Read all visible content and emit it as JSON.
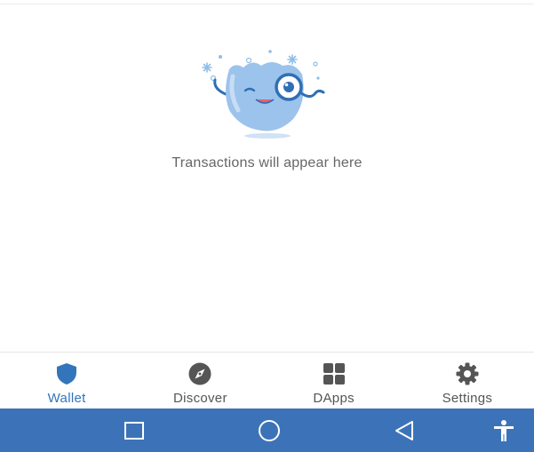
{
  "empty_state": {
    "message": "Transactions will appear here",
    "illustration_icon": "mascot-magnifier-illustration"
  },
  "bottom_nav": {
    "items": [
      {
        "label": "Wallet",
        "icon": "shield-icon",
        "active": true
      },
      {
        "label": "Discover",
        "icon": "compass-icon",
        "active": false
      },
      {
        "label": "DApps",
        "icon": "grid-icon",
        "active": false
      },
      {
        "label": "Settings",
        "icon": "gear-icon",
        "active": false
      }
    ]
  },
  "system_nav": {
    "buttons": [
      "recents-square-icon",
      "home-circle-icon",
      "back-triangle-icon",
      "accessibility-icon"
    ]
  },
  "colors": {
    "accent": "#3375BB",
    "inactive_icon": "#555555",
    "system_bar": "#3C73B8",
    "mascot_body": "#9CC3EC"
  }
}
